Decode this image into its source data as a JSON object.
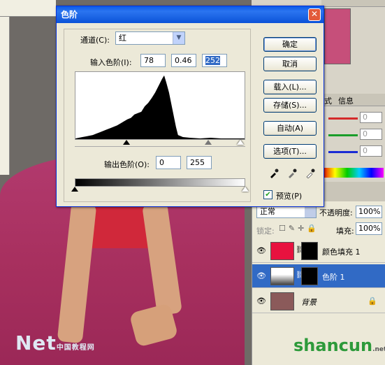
{
  "dialog": {
    "title": "色阶",
    "close_glyph": "✕",
    "channel_label": "通道(C):",
    "channel_value": "红",
    "input_levels_label": "输入色阶(I):",
    "input_black": "78",
    "input_gamma": "0.46",
    "input_white": "252",
    "output_levels_label": "输出色阶(O):",
    "output_black": "0",
    "output_white": "255",
    "buttons": {
      "ok": "确定",
      "cancel": "取消",
      "load": "载入(L)...",
      "save": "存储(S)...",
      "auto": "自动(A)",
      "options": "选项(T)..."
    },
    "preview_label": "预览(P)",
    "preview_checked": true
  },
  "right_panel": {
    "info_tab": "信息",
    "style_tab": "式",
    "color_values": [
      "0",
      "0",
      "0"
    ]
  },
  "layers": {
    "blend_mode": "正常",
    "opacity_label": "不透明度:",
    "opacity_value": "100%",
    "lock_label": "锁定:",
    "fill_label": "填充:",
    "fill_value": "100%",
    "rows": [
      {
        "name": "颜色填充 1",
        "selected": false
      },
      {
        "name": "色阶 1",
        "selected": true
      },
      {
        "name": "背景",
        "selected": false,
        "locked": true
      }
    ]
  },
  "watermarks": {
    "left": "Net",
    "left_small": "中国教程网",
    "brand_green": "shancun",
    "brand_small": ".net"
  },
  "colors": {
    "dialog_bg": "#ece9d8",
    "title_bar": "#0a5ae8",
    "selection": "#316ac5",
    "dress": "#a8305f"
  }
}
